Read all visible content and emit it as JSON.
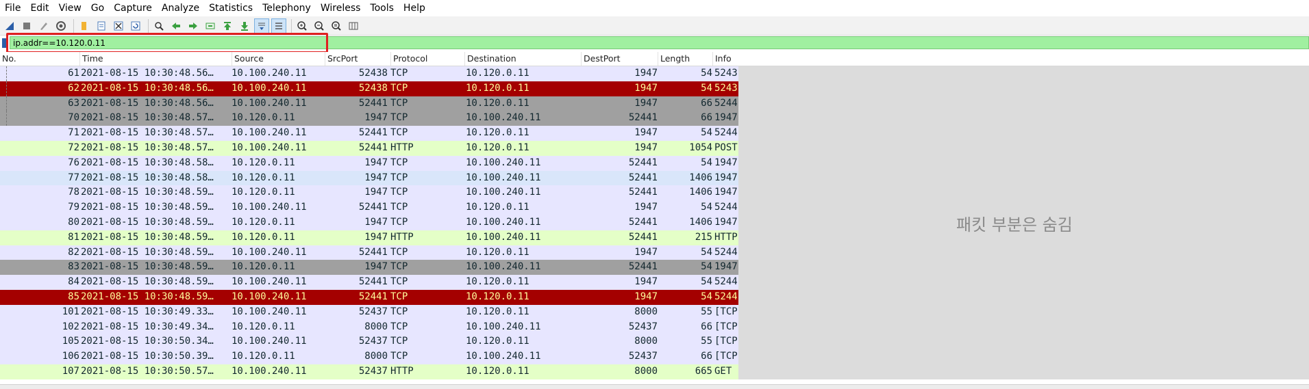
{
  "menu": [
    "File",
    "Edit",
    "View",
    "Go",
    "Capture",
    "Analyze",
    "Statistics",
    "Telephony",
    "Wireless",
    "Tools",
    "Help"
  ],
  "toolbar_icons": [
    "shark-fin-start-icon",
    "stop-square-icon",
    "restart-icon",
    "capture-options-icon",
    "open-folder-icon",
    "save-file-icon",
    "close-file-icon",
    "reload-icon",
    "find-packet-icon",
    "go-back-icon",
    "go-forward-icon",
    "go-to-packet-icon",
    "go-first-icon",
    "go-last-icon",
    "autoscroll-icon",
    "colorize-icon",
    "zoom-in-icon",
    "zoom-out-icon",
    "zoom-normal-icon",
    "resize-columns-icon"
  ],
  "filter": {
    "value": "ip.addr==10.120.0.11"
  },
  "columns": [
    "No.",
    "Time",
    "Source",
    "SrcPort",
    "Protocol",
    "Destination",
    "DestPort",
    "Length",
    "Info"
  ],
  "packets": [
    {
      "no": "61",
      "time": "2021-08-15 10:30:48.56…",
      "src": "10.100.240.11",
      "sport": "52438",
      "proto": "TCP",
      "dst": "10.120.0.11",
      "dport": "1947",
      "len": "54",
      "info": "5243",
      "color": "lav"
    },
    {
      "no": "62",
      "time": "2021-08-15 10:30:48.56…",
      "src": "10.100.240.11",
      "sport": "52438",
      "proto": "TCP",
      "dst": "10.120.0.11",
      "dport": "1947",
      "len": "54",
      "info": "5243",
      "color": "red"
    },
    {
      "no": "63",
      "time": "2021-08-15 10:30:48.56…",
      "src": "10.100.240.11",
      "sport": "52441",
      "proto": "TCP",
      "dst": "10.120.0.11",
      "dport": "1947",
      "len": "66",
      "info": "5244",
      "color": "gray"
    },
    {
      "no": "70",
      "time": "2021-08-15 10:30:48.57…",
      "src": "10.120.0.11",
      "sport": "1947",
      "proto": "TCP",
      "dst": "10.100.240.11",
      "dport": "52441",
      "len": "66",
      "info": "1947",
      "color": "gray"
    },
    {
      "no": "71",
      "time": "2021-08-15 10:30:48.57…",
      "src": "10.100.240.11",
      "sport": "52441",
      "proto": "TCP",
      "dst": "10.120.0.11",
      "dport": "1947",
      "len": "54",
      "info": "5244",
      "color": "lav"
    },
    {
      "no": "72",
      "time": "2021-08-15 10:30:48.57…",
      "src": "10.100.240.11",
      "sport": "52441",
      "proto": "HTTP",
      "dst": "10.120.0.11",
      "dport": "1947",
      "len": "1054",
      "info": "POST",
      "color": "green"
    },
    {
      "no": "76",
      "time": "2021-08-15 10:30:48.58…",
      "src": "10.120.0.11",
      "sport": "1947",
      "proto": "TCP",
      "dst": "10.100.240.11",
      "dport": "52441",
      "len": "54",
      "info": "1947",
      "color": "lav"
    },
    {
      "no": "77",
      "time": "2021-08-15 10:30:48.58…",
      "src": "10.120.0.11",
      "sport": "1947",
      "proto": "TCP",
      "dst": "10.100.240.11",
      "dport": "52441",
      "len": "1406",
      "info": "1947",
      "color": "blue"
    },
    {
      "no": "78",
      "time": "2021-08-15 10:30:48.59…",
      "src": "10.120.0.11",
      "sport": "1947",
      "proto": "TCP",
      "dst": "10.100.240.11",
      "dport": "52441",
      "len": "1406",
      "info": "1947",
      "color": "lav"
    },
    {
      "no": "79",
      "time": "2021-08-15 10:30:48.59…",
      "src": "10.100.240.11",
      "sport": "52441",
      "proto": "TCP",
      "dst": "10.120.0.11",
      "dport": "1947",
      "len": "54",
      "info": "5244",
      "color": "lav"
    },
    {
      "no": "80",
      "time": "2021-08-15 10:30:48.59…",
      "src": "10.120.0.11",
      "sport": "1947",
      "proto": "TCP",
      "dst": "10.100.240.11",
      "dport": "52441",
      "len": "1406",
      "info": "1947",
      "color": "lav"
    },
    {
      "no": "81",
      "time": "2021-08-15 10:30:48.59…",
      "src": "10.120.0.11",
      "sport": "1947",
      "proto": "HTTP",
      "dst": "10.100.240.11",
      "dport": "52441",
      "len": "215",
      "info": "HTTP",
      "color": "green"
    },
    {
      "no": "82",
      "time": "2021-08-15 10:30:48.59…",
      "src": "10.100.240.11",
      "sport": "52441",
      "proto": "TCP",
      "dst": "10.120.0.11",
      "dport": "1947",
      "len": "54",
      "info": "5244",
      "color": "lav"
    },
    {
      "no": "83",
      "time": "2021-08-15 10:30:48.59…",
      "src": "10.120.0.11",
      "sport": "1947",
      "proto": "TCP",
      "dst": "10.100.240.11",
      "dport": "52441",
      "len": "54",
      "info": "1947",
      "color": "gray"
    },
    {
      "no": "84",
      "time": "2021-08-15 10:30:48.59…",
      "src": "10.100.240.11",
      "sport": "52441",
      "proto": "TCP",
      "dst": "10.120.0.11",
      "dport": "1947",
      "len": "54",
      "info": "5244",
      "color": "lav"
    },
    {
      "no": "85",
      "time": "2021-08-15 10:30:48.59…",
      "src": "10.100.240.11",
      "sport": "52441",
      "proto": "TCP",
      "dst": "10.120.0.11",
      "dport": "1947",
      "len": "54",
      "info": "5244",
      "color": "red"
    },
    {
      "no": "101",
      "time": "2021-08-15 10:30:49.33…",
      "src": "10.100.240.11",
      "sport": "52437",
      "proto": "TCP",
      "dst": "10.120.0.11",
      "dport": "8000",
      "len": "55",
      "info": "[TCP",
      "color": "lav"
    },
    {
      "no": "102",
      "time": "2021-08-15 10:30:49.34…",
      "src": "10.120.0.11",
      "sport": "8000",
      "proto": "TCP",
      "dst": "10.100.240.11",
      "dport": "52437",
      "len": "66",
      "info": "[TCP",
      "color": "lav"
    },
    {
      "no": "105",
      "time": "2021-08-15 10:30:50.34…",
      "src": "10.100.240.11",
      "sport": "52437",
      "proto": "TCP",
      "dst": "10.120.0.11",
      "dport": "8000",
      "len": "55",
      "info": "[TCP",
      "color": "lav"
    },
    {
      "no": "106",
      "time": "2021-08-15 10:30:50.39…",
      "src": "10.120.0.11",
      "sport": "8000",
      "proto": "TCP",
      "dst": "10.100.240.11",
      "dport": "52437",
      "len": "66",
      "info": "[TCP",
      "color": "lav"
    },
    {
      "no": "107",
      "time": "2021-08-15 10:30:50.57…",
      "src": "10.100.240.11",
      "sport": "52437",
      "proto": "HTTP",
      "dst": "10.120.0.11",
      "dport": "8000",
      "len": "665",
      "info": "GET",
      "color": "green"
    }
  ],
  "hidden_panel_text": "패킷 부분은 숨김"
}
